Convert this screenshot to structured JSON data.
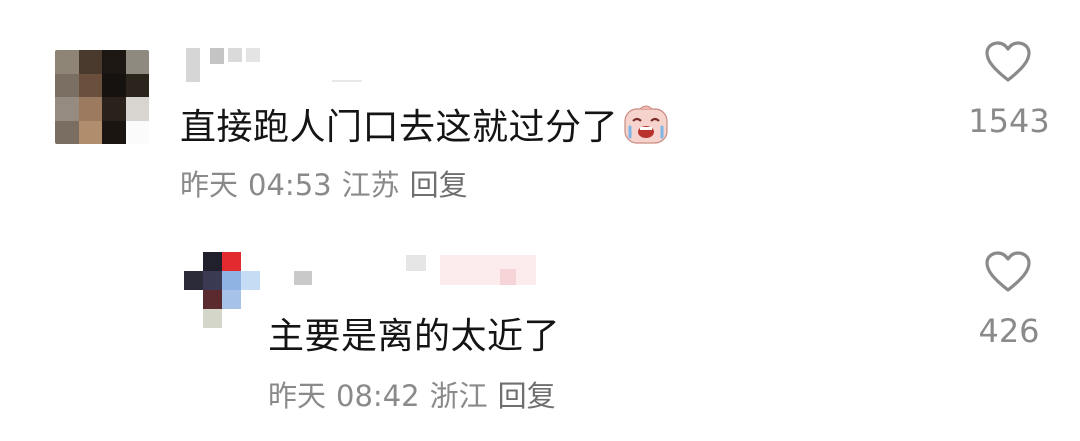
{
  "comments": [
    {
      "text": "直接跑人门口去这就过分了",
      "emoji": "crying-face-emoji",
      "time_label": "昨天",
      "time": "04:53",
      "location": "江苏",
      "reply_label": "回复",
      "likes": "1543"
    },
    {
      "text": "主要是离的太近了",
      "time_label": "昨天",
      "time": "08:42",
      "location": "浙江",
      "reply_label": "回复",
      "likes": "426"
    }
  ],
  "icons": {
    "like": "heart-outline-icon"
  },
  "colors": {
    "text": "#141414",
    "meta": "#8a8a8a",
    "background": "#ffffff"
  }
}
